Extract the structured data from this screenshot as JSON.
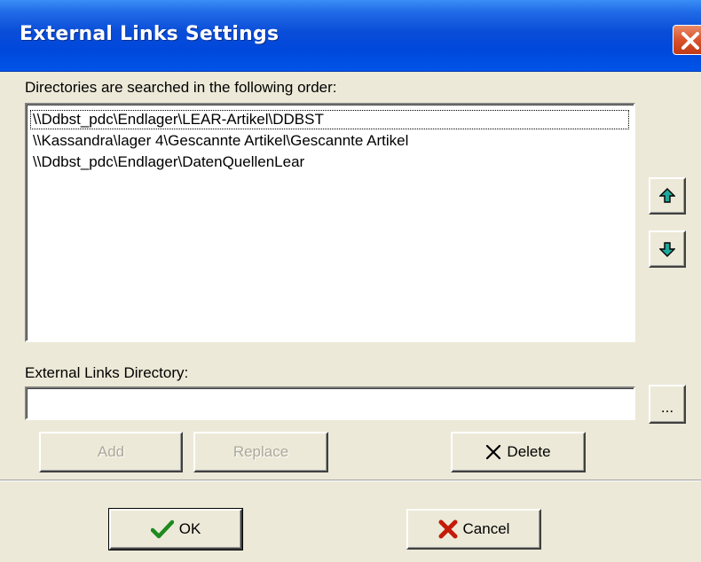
{
  "window": {
    "title": "External Links Settings",
    "close_icon": "close-icon"
  },
  "search_order": {
    "label": "Directories are searched in the following order:",
    "items": [
      "\\\\Ddbst_pdc\\Endlager\\LEAR-Artikel\\DDBST",
      "\\\\Kassandra\\lager 4\\Gescannte Artikel\\Gescannte Artikel",
      "\\\\Ddbst_pdc\\Endlager\\DatenQuellenLear"
    ],
    "selected_index": 0,
    "move_up_icon": "arrow-up-icon",
    "move_down_icon": "arrow-down-icon"
  },
  "directory": {
    "label": "External Links Directory:",
    "value": "",
    "browse_label": "..."
  },
  "actions": {
    "add_label": "Add",
    "replace_label": "Replace",
    "delete_label": "Delete",
    "delete_icon": "x-icon",
    "add_enabled": false,
    "replace_enabled": false
  },
  "footer": {
    "ok_label": "OK",
    "ok_icon": "checkmark-icon",
    "cancel_label": "Cancel",
    "cancel_icon": "cross-icon"
  },
  "colors": {
    "titlebar": "#0A4DD8",
    "face": "#ECE9D8",
    "close": "#D9522C",
    "arrow": "#1FA89A",
    "ok_check": "#1E8A1E",
    "cancel_x": "#C41A0A"
  }
}
